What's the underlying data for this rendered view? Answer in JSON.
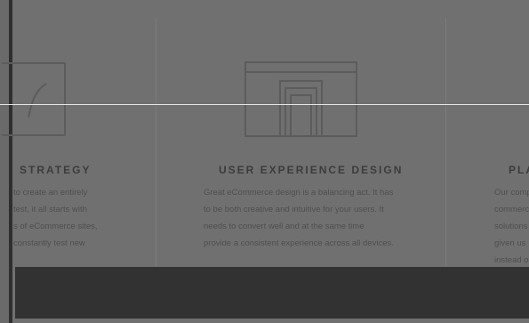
{
  "services": [
    {
      "title": "STRATEGY",
      "icon": "strategy-icon",
      "lines": [
        "to create an entirely",
        "test, it all starts with",
        "s of eCommerce sites,",
        "constantly test new"
      ]
    },
    {
      "title": "USER EXPERIENCE DESIGN",
      "icon": "browser-window-icon",
      "lines": [
        "Great eCommerce design is a balancing act. It has",
        "to be both creative and intuitive for your users. It",
        "needs to convert well and at the same time",
        "provide a consistent experience across all devices."
      ]
    },
    {
      "title": "PLA",
      "icon": "platform-icon",
      "lines": [
        "Our comp",
        "commerc",
        "solutions",
        "given us",
        "instead o"
      ]
    }
  ],
  "colors": {
    "overlay_bg": "#707070",
    "heading": "#3c3c3c",
    "body_text": "#4f4f4f",
    "bottom_bar": "#323232",
    "divider_line": "#e6e6e6"
  }
}
